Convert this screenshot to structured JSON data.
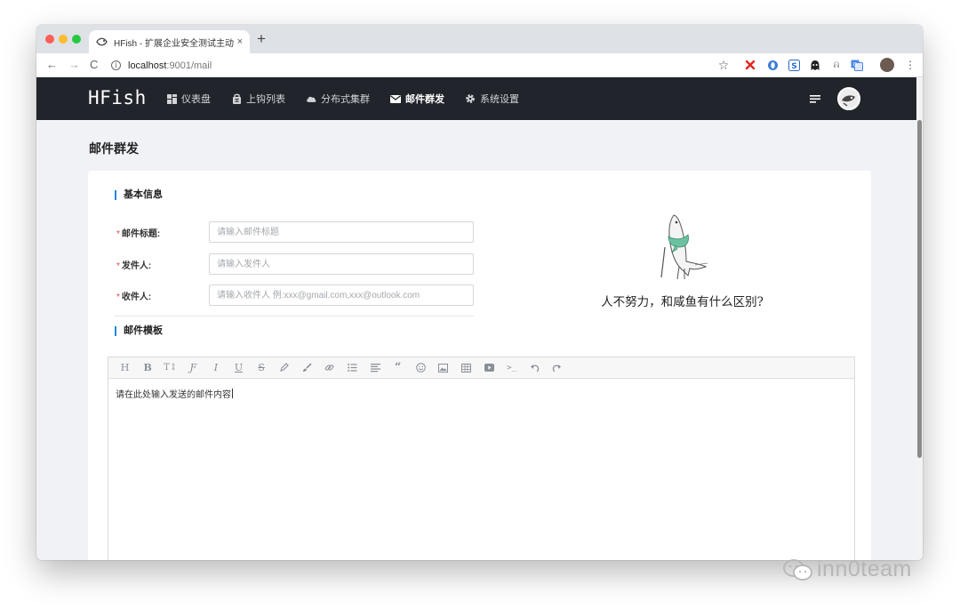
{
  "browser": {
    "tab_title": "HFish - 扩展企业安全测试主动诱",
    "tab_close": "×",
    "new_tab": "+",
    "url_host": "localhost",
    "url_path": ":9001/mail",
    "back": "←",
    "forward": "→",
    "reload": "C",
    "info": "i",
    "bookmark": "☆",
    "extensions": [
      "close-x-extension",
      "opera-extension",
      "s-extension",
      "ghostery-extension",
      "a-extension",
      "translate-extension",
      "profile-avatar",
      "more-menu"
    ]
  },
  "app": {
    "logo": "HFish",
    "nav": [
      {
        "label": "仪表盘",
        "icon": "dashboard-icon"
      },
      {
        "label": "上钩列表",
        "icon": "fish-hook-list-icon"
      },
      {
        "label": "分布式集群",
        "icon": "cloud-icon"
      },
      {
        "label": "邮件群发",
        "icon": "mail-icon",
        "active": true
      },
      {
        "label": "系统设置",
        "icon": "gear-icon"
      }
    ]
  },
  "page": {
    "title": "邮件群发",
    "section_basic": "基本信息",
    "section_template": "邮件模板",
    "fields": {
      "subject_label": "邮件标题:",
      "subject_placeholder": "请输入邮件标题",
      "sender_label": "发件人:",
      "sender_placeholder": "请输入发件人",
      "recipient_label": "收件人:",
      "recipient_placeholder": "请输入收件人 例:xxx@gmail.com,xxx@outlook.com"
    },
    "slogan": "人不努力，和咸鱼有什么区别?",
    "editor": {
      "toolbar": [
        "H",
        "B",
        "T↕",
        "Ƒ",
        "I",
        "U",
        "S",
        "pen",
        "brush",
        "link",
        "ul",
        "align",
        "quote",
        "emoji",
        "image",
        "table",
        "video",
        "terminal",
        "undo",
        "redo"
      ],
      "content": "请在此处输入发送的邮件内容"
    }
  },
  "watermark": "inn0team"
}
